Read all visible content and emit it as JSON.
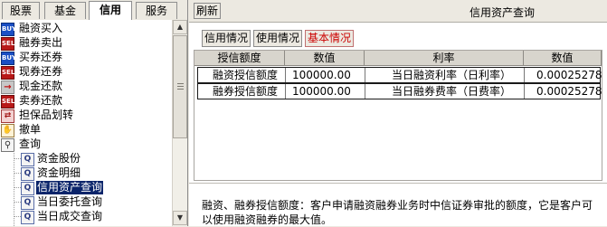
{
  "tabs": [
    "股票",
    "基金",
    "信用",
    "服务"
  ],
  "active_tab": "信用",
  "tree": {
    "items": [
      {
        "label": "融资买入",
        "icon": "buy-icon",
        "icon_text": "BUY"
      },
      {
        "label": "融券卖出",
        "icon": "sell-icon",
        "icon_text": "SELL"
      },
      {
        "label": "买券还券",
        "icon": "buy-icon",
        "icon_text": "BUY"
      },
      {
        "label": "现券还券",
        "icon": "sell-icon",
        "icon_text": "SELL"
      },
      {
        "label": "现金还款",
        "icon": "arrow-right-icon",
        "icon_text": "→"
      },
      {
        "label": "卖券还款",
        "icon": "sell-icon",
        "icon_text": "SELL"
      },
      {
        "label": "担保品划转",
        "icon": "transfer-icon",
        "icon_text": "⇄"
      },
      {
        "label": "撤单",
        "icon": "cancel-hand-icon",
        "icon_text": "✋"
      },
      {
        "label": "查询",
        "icon": "magnifier-icon",
        "icon_text": "⚲"
      }
    ],
    "sub_items": [
      {
        "label": "资金股份",
        "icon": "query-doc-icon"
      },
      {
        "label": "资金明细",
        "icon": "query-doc-icon"
      },
      {
        "label": "信用资产查询",
        "icon": "query-doc-icon",
        "selected": true
      },
      {
        "label": "当日委托查询",
        "icon": "query-doc-icon"
      },
      {
        "label": "当日成交查询",
        "icon": "query-doc-icon"
      }
    ]
  },
  "toolbar": {
    "refresh_label": "刷新",
    "title": "信用资产查询"
  },
  "sub_buttons": [
    "信用情况",
    "使用情况",
    "基本情况"
  ],
  "active_sub_button": "基本情况",
  "grid": {
    "headers": [
      "授信额度",
      "数值",
      "利率",
      "数值"
    ],
    "rows": [
      [
        "融资授信额度",
        "100000.00",
        "当日融资利率（日利率）",
        "0.00025278"
      ],
      [
        "融券授信额度",
        "100000.00",
        "当日融券费率（日费率）",
        "0.00025278"
      ]
    ]
  },
  "description": {
    "line1": "融资、融券授信额度：客户申请融资融券业务时中信证券审批的额度，它是客户可",
    "line2": "以使用融资融券的最大值。"
  }
}
